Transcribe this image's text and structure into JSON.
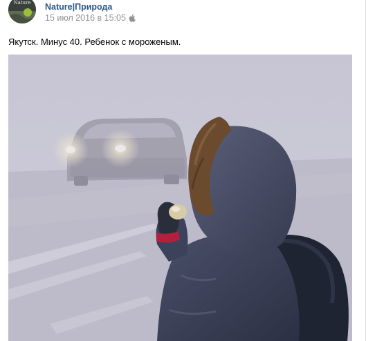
{
  "post": {
    "author": {
      "name": "Nature|Природа",
      "avatar_text": "Nature"
    },
    "date": "15 июл 2016 в 15:05",
    "platform_icon": "apple-icon",
    "text": "Якутск. Минус 40. Ребенок с мороженым.",
    "photo": {
      "icon": "photo",
      "colors": {
        "fog": "#c7c7d3",
        "jacket": "#3a3f55",
        "fur": "#6b4a2e",
        "headlight": "#fffbe8"
      }
    }
  },
  "colors": {
    "link": "#2a5885",
    "secondary_text": "#939393",
    "text": "#000000",
    "border": "#dce1e6"
  }
}
